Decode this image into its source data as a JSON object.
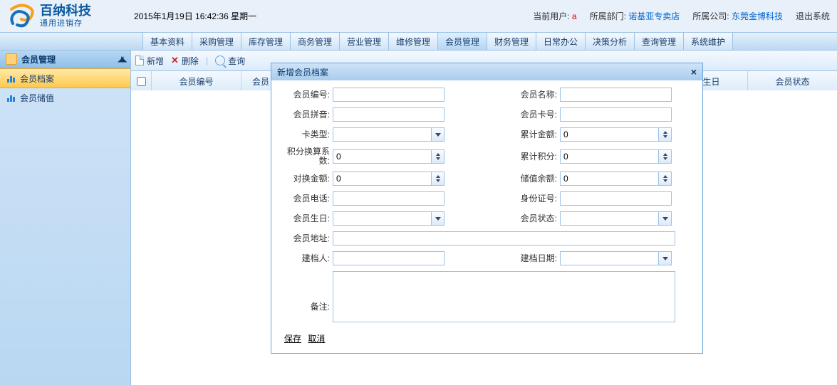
{
  "header": {
    "brand_cn": "百纳科技",
    "brand_sub": "通用进销存",
    "datetime": "2015年1月19日 16:42:36 星期一",
    "user_label": "当前用户:",
    "user_value": "a",
    "dept_label": "所属部门:",
    "dept_value": "诺基亚专卖店",
    "company_label": "所属公司:",
    "company_value": "东莞金博科技",
    "logout": "退出系统"
  },
  "menus": [
    "基本资料",
    "采购管理",
    "库存管理",
    "商务管理",
    "营业管理",
    "维修管理",
    "会员管理",
    "财务管理",
    "日常办公",
    "决策分析",
    "查询管理",
    "系统维护"
  ],
  "menu_active_index": 6,
  "sidebar": {
    "title": "会员管理",
    "items": [
      "会员档案",
      "会员储值"
    ],
    "active_index": 0
  },
  "toolbar": {
    "new": "新增",
    "del": "删除",
    "search": "查询"
  },
  "grid_columns": [
    "会员编号",
    "会员",
    "会员生日",
    "会员状态"
  ],
  "modal": {
    "title": "新增会员档案",
    "labels": {
      "member_no": "会员编号:",
      "member_name": "会员名称:",
      "member_pinyin": "会员拼音:",
      "member_card": "会员卡号:",
      "card_type": "卡类型:",
      "total_amount": "累计金额:",
      "point_ratio": "积分换算系数:",
      "total_points": "累计积分:",
      "exchange_amount": "对换金额:",
      "balance": "储值余额:",
      "phone": "会员电话:",
      "idcard": "身份证号:",
      "birthday": "会员生日:",
      "status": "会员状态:",
      "address": "会员地址:",
      "creator": "建档人:",
      "create_date": "建档日期:",
      "remark": "备注:"
    },
    "values": {
      "member_no": "",
      "member_name": "",
      "member_pinyin": "",
      "member_card": "",
      "card_type": "",
      "total_amount": "0",
      "point_ratio": "0",
      "total_points": "0",
      "exchange_amount": "0",
      "balance": "0",
      "phone": "",
      "idcard": "",
      "birthday": "",
      "status": "",
      "address": "",
      "creator": "",
      "create_date": "",
      "remark": ""
    },
    "actions": {
      "save": "保存",
      "cancel": "取消"
    }
  }
}
